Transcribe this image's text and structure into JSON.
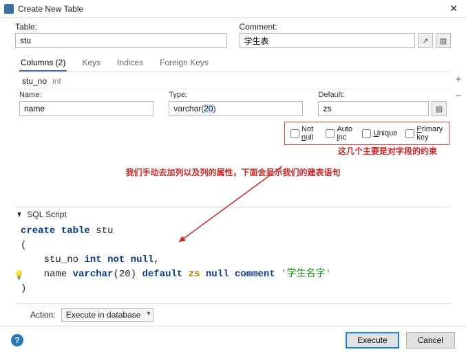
{
  "window": {
    "title": "Create New Table"
  },
  "fields": {
    "table_label": "Table:",
    "table_value": "stu",
    "comment_label": "Comment:",
    "comment_value": "学生表"
  },
  "tabs": {
    "columns": "Columns (2)",
    "keys": "Keys",
    "indices": "Indices",
    "foreign": "Foreign Keys"
  },
  "selected_column": {
    "name": "stu_no",
    "type": "int"
  },
  "prop_labels": {
    "name": "Name:",
    "type": "Type:",
    "default": "Default:"
  },
  "prop_values": {
    "name": "name",
    "type_prefix": "varchar(",
    "type_hl": "20",
    "type_suffix": ")",
    "default": "zs"
  },
  "constraints": {
    "notnull": "Not null",
    "autoinc": "Auto inc",
    "unique": "Unique",
    "primary": "Primary key"
  },
  "annotations": {
    "a1": "这几个主要是对字段的约束",
    "a2": "我们手动去加列以及列的属性，下面会显示我们的建表语句"
  },
  "sql_section": {
    "title": "SQL Script"
  },
  "sql": {
    "l1_kw1": "create table",
    "l1_id": "stu",
    "l2": "(",
    "l3_id": "stu_no",
    "l3_tp": "int",
    "l3_kw": "not null",
    "l3_end": ",",
    "l4_id": "name",
    "l4_tp": "varchar",
    "l4_paren_open": "(",
    "l4_num": "20",
    "l4_paren_close": ")",
    "l4_kw1": "default",
    "l4_dv": "zs",
    "l4_kw2": "null",
    "l4_kw3": "comment",
    "l4_str": "'学生名字'",
    "l5": ")"
  },
  "footer": {
    "action_label": "Action:",
    "action_value": "Execute in database",
    "execute": "Execute",
    "cancel": "Cancel"
  }
}
